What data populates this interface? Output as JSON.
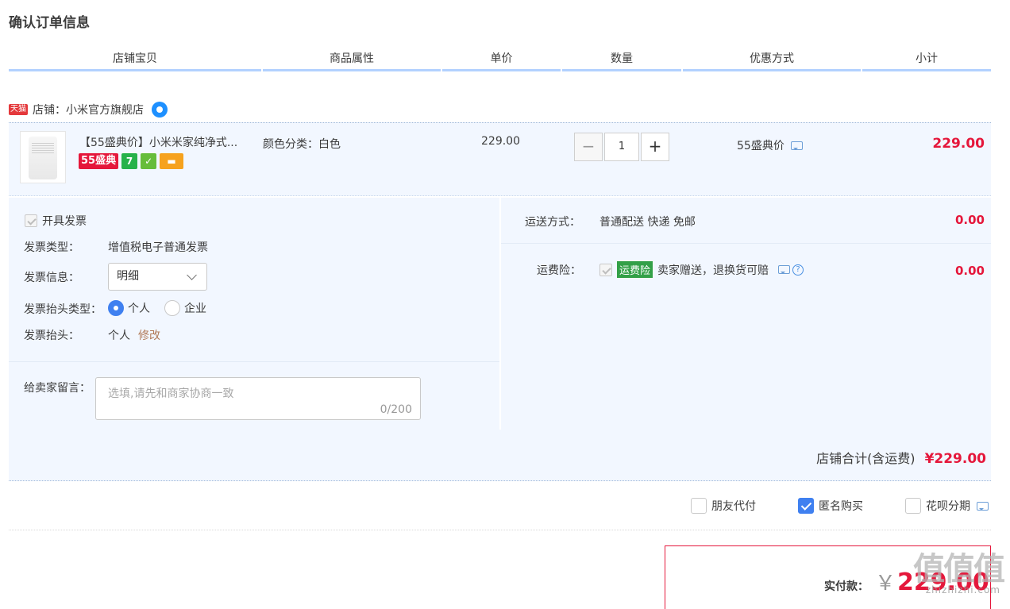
{
  "page_title": "确认订单信息",
  "columns": [
    "店铺宝贝",
    "商品属性",
    "单价",
    "数量",
    "优惠方式",
    "小计"
  ],
  "shop": {
    "tmall_badge": "天猫",
    "label": "店铺：小米官方旗舰店",
    "ww_icon": "wangwang-chat-icon"
  },
  "item": {
    "name": "【55盛典价】小米米家纯净式...",
    "badge_55": "55盛典",
    "badge_7": "7",
    "attr": "颜色分类：白色",
    "unit_price": "229.00",
    "quantity": "1",
    "minus": "−",
    "plus": "+",
    "promo": "55盛典价",
    "subtotal": "229.00"
  },
  "invoice": {
    "open_label": "开具发票",
    "type_label": "发票类型：",
    "type_value": "增值税电子普通发票",
    "info_label": "发票信息：",
    "info_value": "明细",
    "title_type_label": "发票抬头类型：",
    "personal": "个人",
    "company": "企业",
    "title_label": "发票抬头：",
    "title_value": "个人",
    "edit": "修改"
  },
  "message": {
    "label": "给卖家留言：",
    "placeholder": "选填,请先和商家协商一致",
    "counter": "0/200"
  },
  "shipping": {
    "label": "运送方式：",
    "value": "普通配送 快递 免邮",
    "amount": "0.00"
  },
  "insurance": {
    "label": "运费险：",
    "tag": "运费险",
    "text": "卖家赠送，退换货可赔",
    "help": "?",
    "amount": "0.00"
  },
  "shop_total": {
    "label": "店铺合计(含运费)",
    "amount": "¥229.00"
  },
  "options": {
    "friend_pay": "朋友代付",
    "anonymous": "匿名购买",
    "anonymous_checked": true,
    "huabei": "花呗分期"
  },
  "payment": {
    "label": "实付款：",
    "currency": "￥",
    "amount": "229.00"
  },
  "watermark": {
    "logo": "值值值",
    "site": "zhizhizhi.com"
  },
  "colors": {
    "accent_red": "#e5173b",
    "header_line": "#b2d1ff",
    "panel_bg": "#f2f7ff",
    "check_blue": "#3f80f0"
  }
}
